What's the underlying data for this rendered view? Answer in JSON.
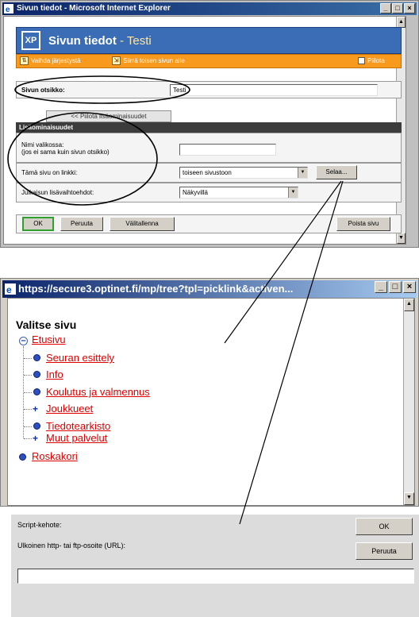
{
  "window1": {
    "title": "Sivun tiedot - Microsoft Internet Explorer",
    "controls": [
      "_",
      "□",
      "×"
    ],
    "header": {
      "title": "Sivun tiedot",
      "subtitle": "- Testi",
      "icon_text": "XP"
    },
    "toolbar": {
      "reorder_label": "Vaihda järjestystä",
      "move_label": "Siirrä toisen sivun alle",
      "hide_label": "Piilota"
    },
    "page_title_label": "Sivun otsikko:",
    "page_title_value": "Testi",
    "hide_extras_button": "<< Piilota lisäominaisuudet",
    "extras_heading": "Lisäominaisuudet",
    "menu_name_label": "Nimi valikossa:",
    "menu_name_hint": "(jos ei sama kuin sivun otsikko)",
    "menu_name_value": "",
    "link_label": "Tämä sivu on linkki:",
    "link_value": "toiseen sivustoon",
    "browse_button": "Selaa...",
    "publish_label": "Julkaisun lisävaihtoehdot:",
    "publish_value": "Näkyvillä",
    "ok_button": "OK",
    "cancel_button": "Peruuta",
    "save_button": "Välitallenna",
    "delete_button": "Poista sivu"
  },
  "window2": {
    "title": "https://secure3.optinet.fi/mp/tree?tpl=picklink&activen...",
    "controls": [
      "_",
      "□",
      "×"
    ],
    "tree_title": "Valitse sivu",
    "root": "Etusivu",
    "children": [
      {
        "label": "Seuran esittely",
        "icon": "bullet-icon"
      },
      {
        "label": "Info",
        "icon": "bullet-icon"
      },
      {
        "label": "Koulutus ja valmennus",
        "icon": "bullet-icon"
      },
      {
        "label": "Joukkueet",
        "icon": "plus-icon"
      },
      {
        "label": "Tiedotearkisto",
        "icon": "bullet-icon"
      },
      {
        "label": "Muut palvelut",
        "icon": "plus-icon"
      }
    ],
    "trash": "Roskakori"
  },
  "dialog": {
    "title_label": "Script-kehote:",
    "prompt_label": "Ulkoinen http- tai ftp-osoite (URL):",
    "url_value": "",
    "ok_button": "OK",
    "cancel_button": "Peruuta"
  },
  "colors": {
    "header_blue": "#3a6db5",
    "toolbar_orange": "#f79a1e",
    "link_red": "#e00000",
    "ok_green": "#2fa02f"
  }
}
